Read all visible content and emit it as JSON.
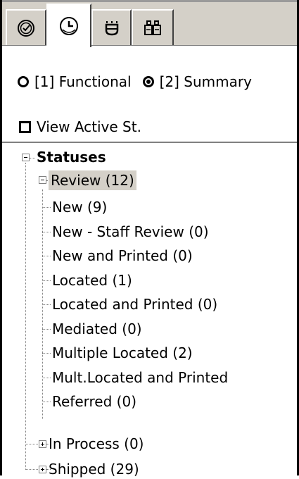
{
  "tabs": [
    {
      "icon": "clock-check-icon",
      "active": false
    },
    {
      "icon": "clock-icon",
      "active": true
    },
    {
      "icon": "cup-icon",
      "active": false
    },
    {
      "icon": "binoculars-icon",
      "active": false
    }
  ],
  "view_options": {
    "radio_functional": {
      "label": "[1] Functional",
      "selected": false
    },
    "radio_summary": {
      "label": "[2] Summary",
      "selected": true
    },
    "checkbox_active": {
      "label": "View Active St.",
      "checked": false
    }
  },
  "tree": {
    "root": {
      "label": "Statuses",
      "expanded": true
    },
    "review": {
      "label": "Review (12)",
      "expanded": true,
      "selected": true
    },
    "review_children": [
      "New (9)",
      "New - Staff Review (0)",
      "New and Printed (0)",
      "Located (1)",
      "Located and Printed (0)",
      "Mediated (0)",
      "Multiple Located (2)",
      "Mult.Located and Printed",
      "Referred (0)"
    ],
    "in_process": {
      "label": "In Process (0)",
      "expanded": false
    },
    "shipped": {
      "label": "Shipped (29)",
      "expanded": false
    }
  },
  "colors": {
    "face": "#d4d0c8",
    "shadow": "#808080",
    "selection": "#d4d0c8"
  }
}
